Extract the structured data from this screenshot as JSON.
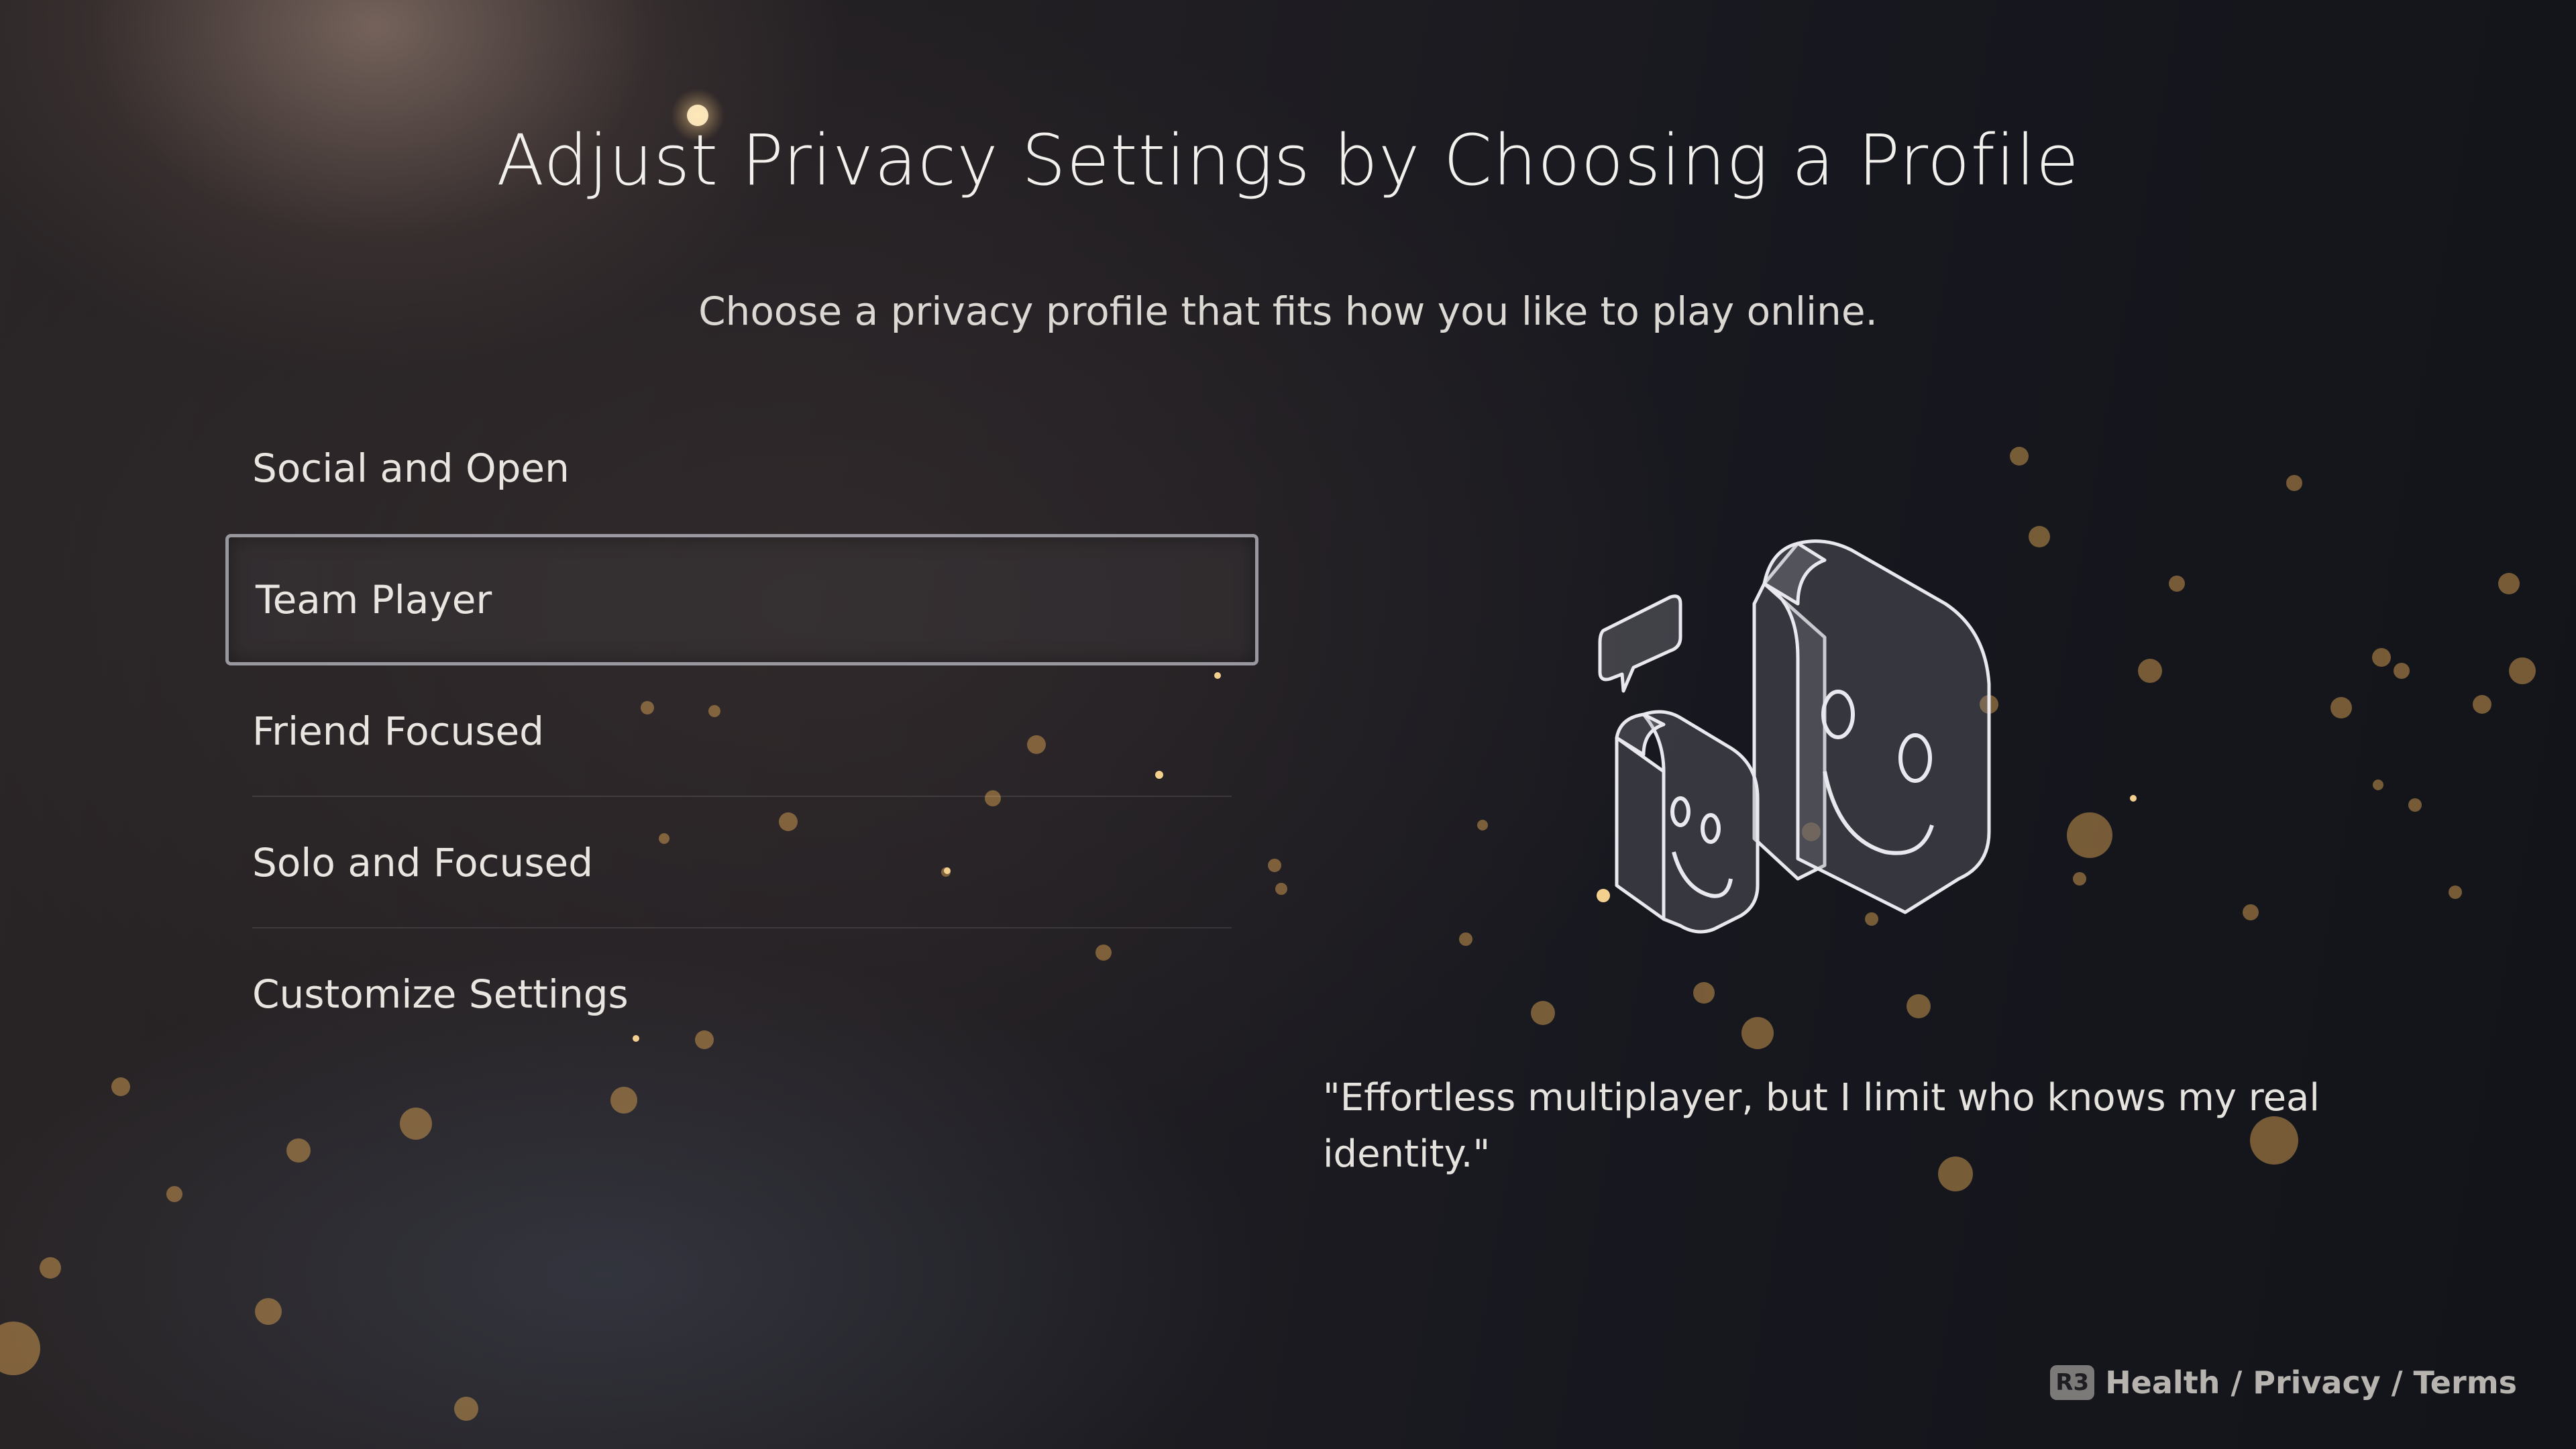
{
  "header": {
    "title": "Adjust Privacy Settings by Choosing a Profile",
    "subtitle": "Choose a privacy profile that fits how you like to play online."
  },
  "profiles": [
    {
      "label": "Social and Open",
      "selected": false
    },
    {
      "label": "Team Player",
      "selected": true
    },
    {
      "label": "Friend Focused",
      "selected": false
    },
    {
      "label": "Solo and Focused",
      "selected": false
    },
    {
      "label": "Customize Settings",
      "selected": false
    }
  ],
  "detail": {
    "illustration_icon": "smiling-faces-with-speech-bubble-icon",
    "quote": "\"Effortless multiplayer, but I limit who knows my real identity.\""
  },
  "footer": {
    "button_glyph": "R3",
    "links_label": "Health / Privacy / Terms"
  },
  "colors": {
    "background": "#14151c",
    "text": "#f2f0ec",
    "selection_border": "#c8c8d2",
    "particle": "#d9a65a"
  }
}
